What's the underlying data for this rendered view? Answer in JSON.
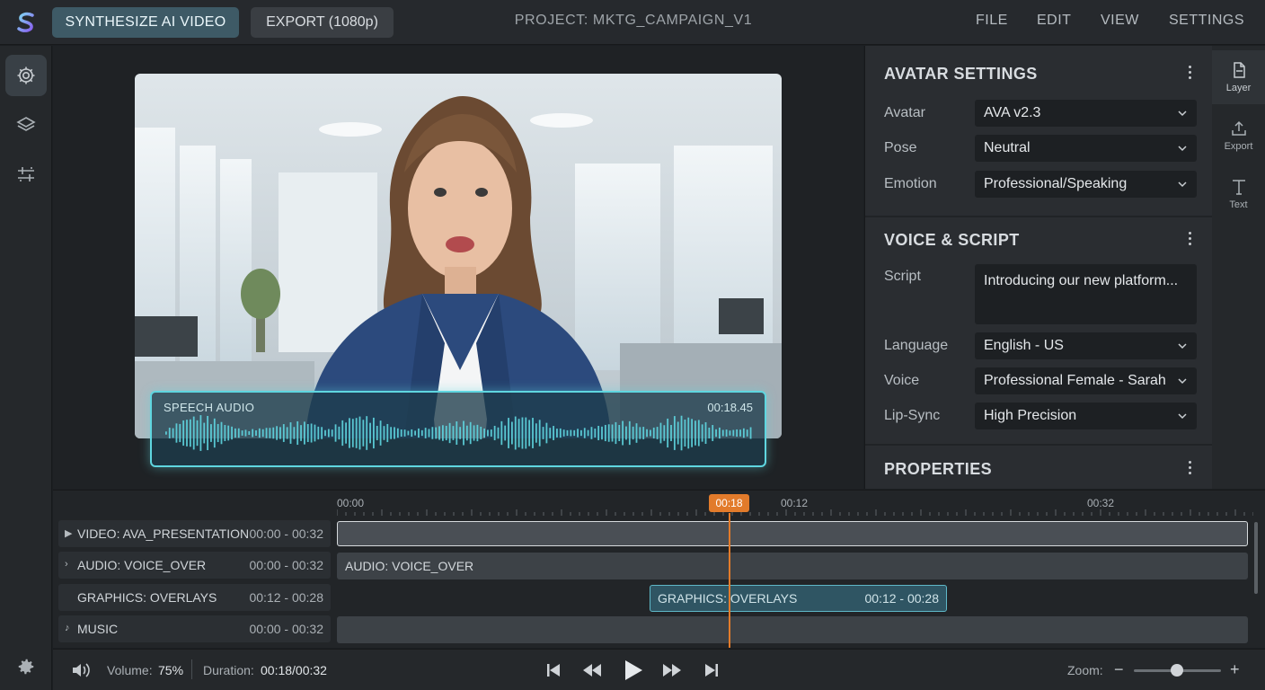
{
  "topbar": {
    "synthesize_label": "SYNTHESIZE AI VIDEO",
    "export_label": "EXPORT (1080p)",
    "project_title": "PROJECT: MKTG_CAMPAIGN_V1",
    "menu": [
      "FILE",
      "EDIT",
      "VIEW",
      "SETTINGS"
    ]
  },
  "sidebar": {
    "items": [
      "settings-icon",
      "layers-icon",
      "adjust-icon"
    ],
    "bottom": "gear-icon"
  },
  "preview": {
    "speech_label": "SPEECH AUDIO",
    "speech_time": "00:18.45"
  },
  "avatar_settings": {
    "title": "AVATAR SETTINGS",
    "rows": [
      {
        "label": "Avatar",
        "value": "AVA v2.3"
      },
      {
        "label": "Pose",
        "value": "Neutral"
      },
      {
        "label": "Emotion",
        "value": "Professional/Speaking"
      }
    ]
  },
  "voice_script": {
    "title": "VOICE & SCRIPT",
    "script_label": "Script",
    "script_value": "Introducing our new platform...",
    "rows": [
      {
        "label": "Language",
        "value": "English - US"
      },
      {
        "label": "Voice",
        "value": "Professional Female - Sarah"
      },
      {
        "label": "Lip-Sync",
        "value": "High Precision"
      }
    ]
  },
  "properties": {
    "title": "PROPERTIES"
  },
  "tools": [
    "Layer",
    "Export",
    "Text"
  ],
  "timeline": {
    "ruler": [
      "00:00",
      "00:12",
      "00:32"
    ],
    "playhead": "00:18",
    "tracks": [
      {
        "name": "VIDEO: AVA_PRESENTATION",
        "range": "00:00 - 00:32"
      },
      {
        "name": "AUDIO: VOICE_OVER",
        "range": "00:00 - 00:32"
      },
      {
        "name": "GRAPHICS: OVERLAYS",
        "range": "00:12 - 00:28"
      },
      {
        "name": "MUSIC",
        "range": "00:00 - 00:32"
      }
    ],
    "clips": {
      "audio_label": "AUDIO: VOICE_OVER",
      "graphics_label": "GRAPHICS: OVERLAYS",
      "graphics_range": "00:12 - 00:28"
    }
  },
  "bottombar": {
    "volume_label": "Volume:",
    "volume_value": "75%",
    "duration_label": "Duration:",
    "duration_value": "00:18/00:32",
    "zoom_label": "Zoom:",
    "zoom_level": 0.5
  },
  "colors": {
    "accent": "#5fd6e0",
    "playhead": "#e27b2b",
    "synth_button": "#3e5a66"
  }
}
